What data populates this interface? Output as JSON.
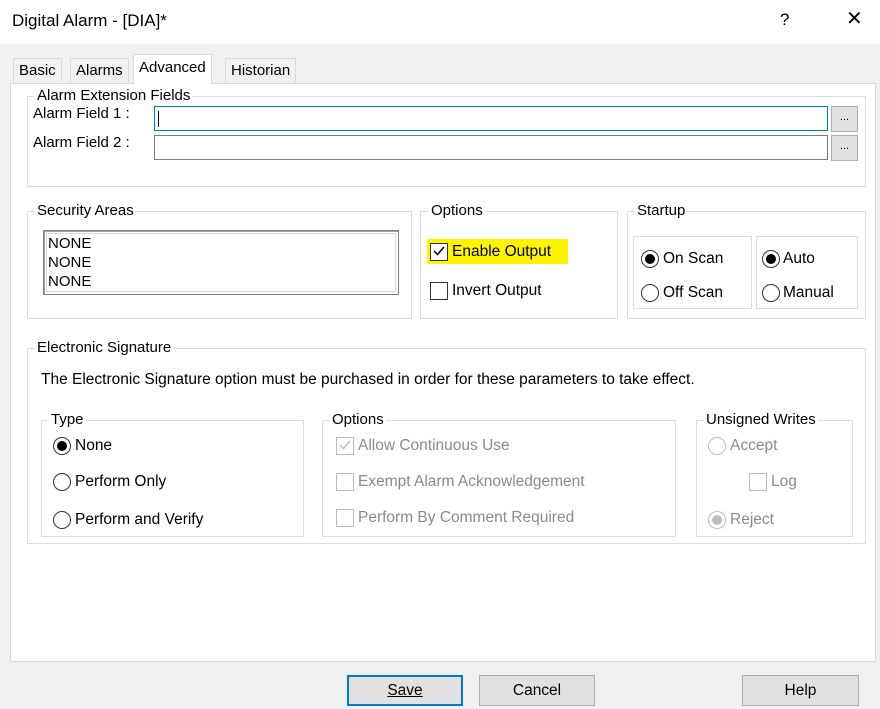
{
  "window": {
    "title": "Digital Alarm - [DIA]*",
    "help_glyph": "?",
    "close_glyph": "✕"
  },
  "tabs": [
    {
      "label": "Basic",
      "active": false
    },
    {
      "label": "Alarms",
      "active": false
    },
    {
      "label": "Advanced",
      "active": true
    },
    {
      "label": "Historian",
      "active": false
    }
  ],
  "alarm_extension": {
    "legend": "Alarm Extension Fields",
    "field1_label": "Alarm Field 1 :",
    "field1_value": "",
    "field2_label": "Alarm Field 2 :",
    "field2_value": "",
    "browse_label": "..."
  },
  "security_areas": {
    "legend": "Security Areas",
    "items": [
      "NONE",
      "NONE",
      "NONE"
    ]
  },
  "options": {
    "legend": "Options",
    "enable_output_label": "Enable Output",
    "enable_output_checked": true,
    "invert_output_label": "Invert Output",
    "invert_output_checked": false
  },
  "startup": {
    "legend": "Startup",
    "on_scan_label": "On Scan",
    "off_scan_label": "Off Scan",
    "scan_selected": "On Scan",
    "auto_label": "Auto",
    "manual_label": "Manual",
    "mode_selected": "Auto"
  },
  "esig": {
    "legend": "Electronic Signature",
    "notice": "The Electronic Signature option must be purchased in order for these parameters to take effect.",
    "type_legend": "Type",
    "type_none": "None",
    "type_perform_only": "Perform Only",
    "type_perform_verify": "Perform and Verify",
    "type_selected": "None",
    "options_legend": "Options",
    "allow_continuous": "Allow Continuous Use",
    "exempt_ack": "Exempt Alarm Acknowledgement",
    "perform_by_comment": "Perform By Comment Required",
    "unsigned_legend": "Unsigned Writes",
    "accept": "Accept",
    "log": "Log",
    "reject": "Reject"
  },
  "buttons": {
    "save": "Save",
    "cancel": "Cancel",
    "help": "Help"
  },
  "colors": {
    "highlight": "#fff400",
    "focus_blue": "#0078d7"
  }
}
